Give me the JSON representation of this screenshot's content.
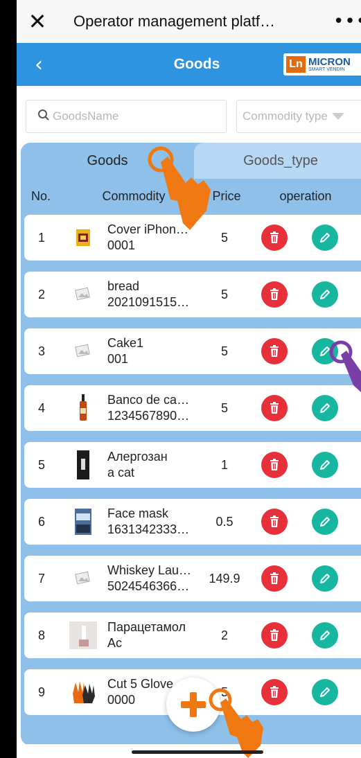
{
  "window": {
    "title": "Operator management platf…",
    "close_glyph": "✕",
    "more_glyph": "•••"
  },
  "nav": {
    "back_glyph": "‹",
    "title": "Goods",
    "logo_text": "MICRON",
    "logo_sub": "SMART VENDIN",
    "logo_mark": "Ln"
  },
  "filters": {
    "search_placeholder": "GoodsName",
    "type_placeholder": "Commodity type"
  },
  "tabs": [
    {
      "label": "Goods",
      "active": true
    },
    {
      "label": "Goods_type",
      "active": false
    }
  ],
  "table": {
    "headers": {
      "no": "No.",
      "commodity": "Commodity",
      "price": "Price",
      "operation": "operation"
    },
    "rows": [
      {
        "no": "1",
        "name": "Cover iPhon…",
        "code": "0001",
        "price": "5",
        "thumb": "yellow-box"
      },
      {
        "no": "2",
        "name": "bread",
        "code": "2021091515…",
        "price": "5",
        "thumb": "placeholder"
      },
      {
        "no": "3",
        "name": "Cake1",
        "code": "001",
        "price": "5",
        "thumb": "placeholder"
      },
      {
        "no": "4",
        "name": "Banco de ca…",
        "code": "1234567890…",
        "price": "5",
        "thumb": "bottle"
      },
      {
        "no": "5",
        "name": "Алергозан",
        "code": "a cat",
        "price": "1",
        "thumb": "dark-card"
      },
      {
        "no": "6",
        "name": "Face mask",
        "code": "1631342333…",
        "price": "0.5",
        "thumb": "mask-box"
      },
      {
        "no": "7",
        "name": "Whiskey Lau…",
        "code": "5024546366…",
        "price": "149.9",
        "thumb": "placeholder"
      },
      {
        "no": "8",
        "name": "Парацетамол",
        "code": "Ac",
        "price": "2",
        "thumb": "room"
      },
      {
        "no": "9",
        "name": "Cut 5 Glove",
        "code": "0000",
        "price": "5",
        "thumb": "gloves"
      }
    ]
  },
  "colors": {
    "nav_bg": "#2f94df",
    "panel_bg": "#8ec0ea",
    "delete": "#e8303a",
    "edit": "#17b6a0",
    "hand": "#f07812"
  },
  "icons": {
    "delete": "trash-icon",
    "edit": "pencil-icon",
    "add": "plus-icon"
  }
}
